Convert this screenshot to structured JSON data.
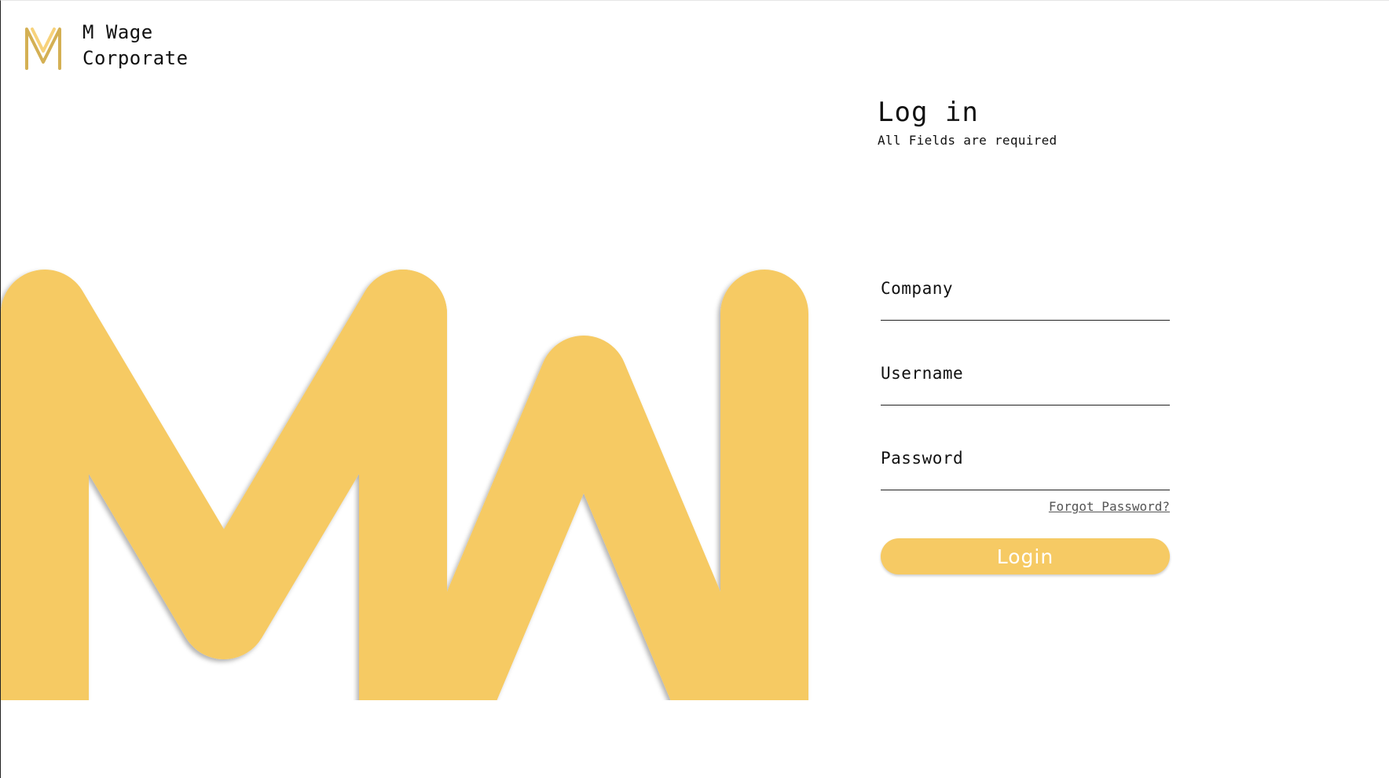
{
  "brand": {
    "logo_icon": "mw-monogram-icon",
    "name_line1": "M Wage",
    "name_line2": "Corporate"
  },
  "hero": {
    "graphic": "mw-monogram-large",
    "color": "#F6CA64"
  },
  "login": {
    "title": "Log in",
    "subtitle": "All Fields are required",
    "fields": [
      {
        "label": "Company",
        "value": "",
        "placeholder": ""
      },
      {
        "label": "Username",
        "value": "",
        "placeholder": ""
      },
      {
        "label": "Password",
        "value": "",
        "placeholder": ""
      }
    ],
    "forgot_label": "Forgot Password?",
    "submit_label": "Login"
  },
  "colors": {
    "accent": "#F6CA64",
    "accent_dark": "#D4B054",
    "text": "#111111",
    "muted": "#555555",
    "background": "#FFFFFF"
  }
}
